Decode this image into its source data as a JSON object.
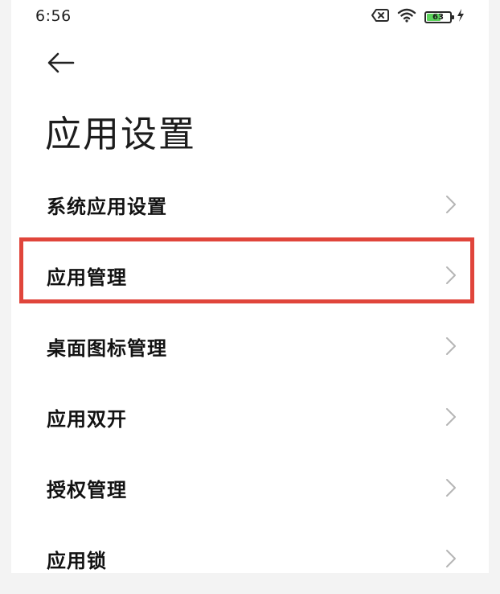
{
  "status_bar": {
    "time": "6:56",
    "battery_level": "63",
    "battery_color": "#5bd35b",
    "icons": [
      "sim-error-icon",
      "wifi-icon",
      "battery-icon",
      "charging-icon"
    ]
  },
  "header": {
    "back_icon": "arrow-left-icon",
    "title": "应用设置"
  },
  "menu": {
    "items": [
      {
        "label": "系统应用设置"
      },
      {
        "label": "应用管理",
        "highlighted": true
      },
      {
        "label": "桌面图标管理"
      },
      {
        "label": "应用双开"
      },
      {
        "label": "授权管理"
      },
      {
        "label": "应用锁"
      }
    ],
    "highlight_color": "#e0453b"
  }
}
